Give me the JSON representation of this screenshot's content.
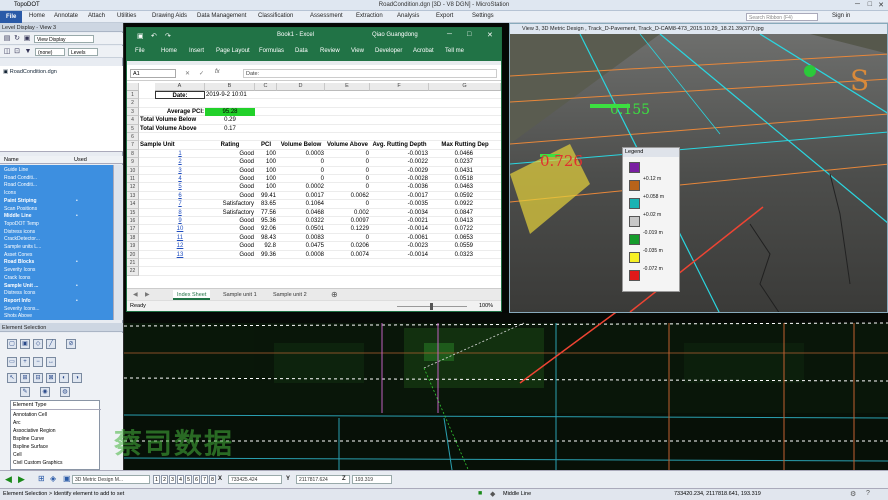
{
  "app": {
    "name": "TopoDOT",
    "title": "RoadCondition.dgn [3D - V8 DGN] - MicroStation"
  },
  "ribbon": {
    "tabs": [
      "File",
      "Home",
      "Annotate",
      "Attach",
      "Utilities",
      "Drawing Aids",
      "Data Management",
      "Classification",
      "Assessment",
      "Extraction",
      "Analysis",
      "Export",
      "Settings"
    ],
    "search_placeholder": "Search Ribbon (F4)",
    "user": "Sign in"
  },
  "level_display": {
    "title": "Level Display - View 3",
    "mode": "View Display",
    "filter": "(none)",
    "levels_label": "Levels",
    "file": "RoadCondition.dgn"
  },
  "levels_list": {
    "col_name": "Name",
    "col_used": "Used",
    "items": [
      {
        "label": "Guide Line",
        "bold": false,
        "used": false
      },
      {
        "label": "Road Conditi...",
        "bold": false,
        "used": false
      },
      {
        "label": "Road Conditi...",
        "bold": false,
        "used": false
      },
      {
        "label": "Icons",
        "bold": false,
        "used": false
      },
      {
        "label": "Paint Striping",
        "bold": true,
        "used": true
      },
      {
        "label": "Scan Positions",
        "bold": false,
        "used": false
      },
      {
        "label": "Middle Line",
        "bold": true,
        "used": true
      },
      {
        "label": "TopoDOT Temp",
        "bold": false,
        "used": false
      },
      {
        "label": "Distress icons",
        "bold": false,
        "used": false
      },
      {
        "label": "CrackDetector...",
        "bold": false,
        "used": false
      },
      {
        "label": "Sample units L...",
        "bold": false,
        "used": false
      },
      {
        "label": "Asset Cones",
        "bold": false,
        "used": false
      },
      {
        "label": "Road Blocks",
        "bold": true,
        "used": true
      },
      {
        "label": "Severity Icons",
        "bold": false,
        "used": false
      },
      {
        "label": "Crack Icons",
        "bold": false,
        "used": false
      },
      {
        "label": "Sample Unit ...",
        "bold": true,
        "used": true
      },
      {
        "label": "Distress Icons",
        "bold": false,
        "used": false
      },
      {
        "label": "Report Info",
        "bold": true,
        "used": true
      },
      {
        "label": "Severity Icons...",
        "bold": false,
        "used": false
      },
      {
        "label": "Shots Above",
        "bold": false,
        "used": false
      }
    ]
  },
  "element_selection": {
    "title": "Element Selection",
    "type_header": "Element Type",
    "types": [
      "Annotation Cell",
      "Arc",
      "Associative Region",
      "Bspline Curve",
      "Bspline Surface",
      "Cell",
      "Civil Custom Graphics"
    ]
  },
  "excel": {
    "title": "Book1 - Excel",
    "user": "Qiao Guangdong",
    "menu": [
      "File",
      "Home",
      "Insert",
      "Page Layout",
      "Formulas",
      "Data",
      "Review",
      "View",
      "Developer",
      "Acrobat",
      "Tell me"
    ],
    "cell_ref": "A1",
    "formula_prefix": "fx",
    "formula": "Date:",
    "columns": [
      "A",
      "B",
      "C",
      "D",
      "E",
      "F",
      "G"
    ],
    "summary": {
      "date_label": "Date:",
      "date_value": "2019-9-2 10:01",
      "pci_label": "Average PCI:",
      "pci_value": "95.28",
      "below_label": "Total Volume Below",
      "below_value": "0.29",
      "above_label": "Total Volume Above",
      "above_value": "0.17"
    },
    "headers": [
      "Sample Unit",
      "Rating",
      "PCI",
      "Volume Below",
      "Volume Above",
      "Avg. Rutting Depth",
      "Max Rutting Dep"
    ],
    "rows": [
      [
        "1",
        "Good",
        "100",
        "0.0003",
        "0",
        "-0.0013",
        "0.0466"
      ],
      [
        "2",
        "Good",
        "100",
        "0",
        "0",
        "-0.0022",
        "0.0237"
      ],
      [
        "3",
        "Good",
        "100",
        "0",
        "0",
        "-0.0029",
        "0.0431"
      ],
      [
        "4",
        "Good",
        "100",
        "0",
        "0",
        "-0.0028",
        "0.0518"
      ],
      [
        "5",
        "Good",
        "100",
        "0.0002",
        "0",
        "-0.0036",
        "0.0463"
      ],
      [
        "6",
        "Good",
        "99.41",
        "0.0017",
        "0.0062",
        "-0.0017",
        "0.0592"
      ],
      [
        "7",
        "Satisfactory",
        "83.65",
        "0.1064",
        "0",
        "-0.0035",
        "0.0922"
      ],
      [
        "8",
        "Satisfactory",
        "77.56",
        "0.0468",
        "0.002",
        "-0.0034",
        "0.0847"
      ],
      [
        "9",
        "Good",
        "95.36",
        "0.0322",
        "0.0097",
        "-0.0021",
        "0.0413"
      ],
      [
        "10",
        "Good",
        "92.06",
        "0.0501",
        "0.1229",
        "-0.0014",
        "0.0722"
      ],
      [
        "11",
        "Good",
        "98.43",
        "0.0083",
        "0",
        "-0.0061",
        "0.0653"
      ],
      [
        "12",
        "Good",
        "92.8",
        "0.0475",
        "0.0206",
        "-0.0023",
        "0.0559"
      ],
      [
        "13",
        "Good",
        "99.36",
        "0.0008",
        "0.0074",
        "-0.0014",
        "0.0323"
      ]
    ],
    "row_numbers": [
      "1",
      "2",
      "3",
      "4",
      "5",
      "6",
      "7",
      "8",
      "9",
      "10",
      "11",
      "12",
      "13",
      "14",
      "15",
      "16",
      "17",
      "18",
      "19",
      "20",
      "21",
      "22"
    ],
    "sheet_tabs": [
      "Index Sheet",
      "Sample unit 1",
      "Sample unit 2"
    ],
    "status": "Ready",
    "zoom": "100%"
  },
  "photo_view": {
    "title": "View 3, 3D Metric Design , Track_D-Pavement, Track_D-CAM8-473_2015.10.29_18.21.39(377).jpg",
    "label_a": "0.155",
    "label_b": "0.726",
    "label_s": "S"
  },
  "legend": {
    "title": "Legend",
    "items": [
      {
        "color": "#7a1fa2",
        "label": ""
      },
      {
        "color": "#b8631a",
        "label": "+0.12  m"
      },
      {
        "color": "#19b3b3",
        "label": "+0.058  m"
      },
      {
        "color": "#c7c7c7",
        "label": "+0.02  m"
      },
      {
        "color": "#159b2b",
        "label": "-0.019  m"
      },
      {
        "color": "#f6f025",
        "label": "-0.035  m"
      },
      {
        "color": "#e11919",
        "label": "-0.072  m"
      }
    ]
  },
  "watermark": "蔡司数据",
  "bottom_toolbar": {
    "view_model": "3D Metric Design M...",
    "views": [
      "1",
      "2",
      "3",
      "4",
      "5",
      "6",
      "7",
      "8"
    ],
    "x_label": "X",
    "x_value": "733425.424",
    "y_label": "Y",
    "y_value": "2117817.624",
    "z_label": "Z",
    "z_value": "193.319"
  },
  "status_bar": {
    "prompt": "Element Selection > Identify element to add to set",
    "level": "Middle Line",
    "coords": "733420.234, 2117818.641, 193.319"
  }
}
